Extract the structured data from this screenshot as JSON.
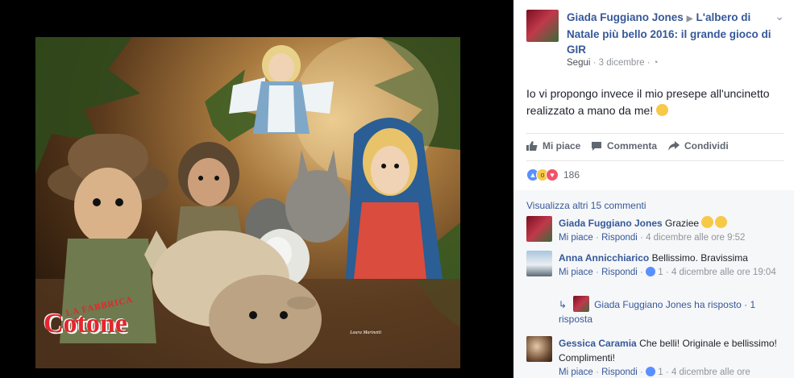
{
  "photo": {
    "watermark_top": "LA FABBRICA DI",
    "watermark_main": "Cotone",
    "signature": "Laura Marinetti"
  },
  "post": {
    "author": "Giada Fuggiano Jones",
    "arrow": "▶",
    "group": "L'albero di Natale più bello 2016: il grande gioco di GIR",
    "follow": "Segui",
    "date": "3 dicembre",
    "text": "Io vi propongo invece il mio presepe all'uncinetto realizzato a mano da me!",
    "actions": {
      "like": "Mi piace",
      "comment": "Commenta",
      "share": "Condividi"
    },
    "reactions_count": "186"
  },
  "comments": {
    "view_more": "Visualizza altri 15 commenti",
    "items": [
      {
        "name": "Giada Fuggiano Jones",
        "text": "Graziee",
        "like": "Mi piace",
        "reply": "Rispondi",
        "sep": "·",
        "time": "4 dicembre alle ore 9:52"
      },
      {
        "name": "Anna Annicchiarico",
        "text": "Bellissimo. Bravissima",
        "like": "Mi piace",
        "reply": "Rispondi",
        "sep": "·",
        "likes": "1",
        "time": "4 dicembre alle ore 19:04"
      },
      {
        "name": "Gessica Caramia",
        "text": "Che belli! Originale e bellissimo! Complimenti!",
        "like": "Mi piace",
        "reply": "Rispondi",
        "sep": "·",
        "likes": "1",
        "time": "4 dicembre alle ore"
      }
    ],
    "reply_summary": "Giada Fuggiano Jones ha risposto · 1 risposta"
  },
  "colors": {
    "link": "#365899",
    "muted": "#90949c",
    "like_blue": "#5890ff",
    "love_red": "#f25268",
    "wow_yellow": "#f7c948"
  }
}
